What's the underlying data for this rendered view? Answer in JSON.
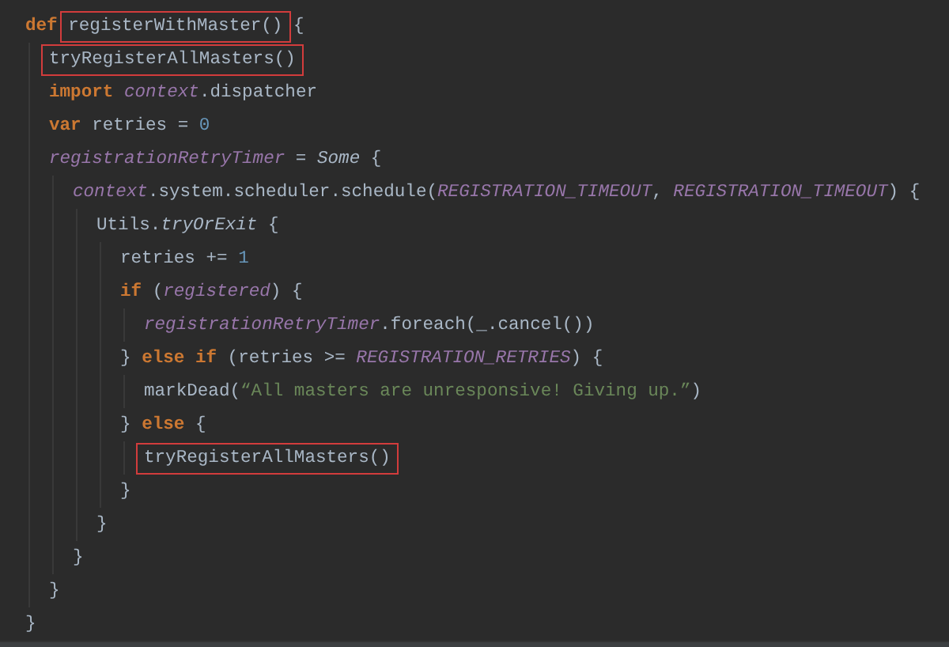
{
  "editor": {
    "lines": [
      {
        "tokens": [
          {
            "kind": "keyword",
            "text": "def "
          },
          {
            "kind": "plain",
            "text": "registerWithMaster()",
            "boxed": true
          },
          {
            "kind": "plain",
            "text": " {"
          }
        ],
        "children": [
          {
            "tokens": [
              {
                "kind": "plain",
                "text": "tryRegisterAllMasters()",
                "boxed": true
              }
            ]
          },
          {
            "tokens": [
              {
                "kind": "keyword",
                "text": "import "
              },
              {
                "kind": "member",
                "text": "context"
              },
              {
                "kind": "plain",
                "text": ".dispatcher"
              }
            ]
          },
          {
            "tokens": [
              {
                "kind": "keyword",
                "text": "var"
              },
              {
                "kind": "plain",
                "text": " retries = "
              },
              {
                "kind": "number",
                "text": "0"
              }
            ]
          },
          {
            "tokens": [
              {
                "kind": "member",
                "text": "registrationRetryTimer"
              },
              {
                "kind": "plain",
                "text": " = "
              },
              {
                "kind": "call",
                "text": "Some"
              },
              {
                "kind": "plain",
                "text": " {"
              }
            ],
            "children": [
              {
                "tokens": [
                  {
                    "kind": "member",
                    "text": "context"
                  },
                  {
                    "kind": "plain",
                    "text": ".system.scheduler.schedule("
                  },
                  {
                    "kind": "member",
                    "text": "REGISTRATION_TIMEOUT"
                  },
                  {
                    "kind": "plain",
                    "text": ", "
                  },
                  {
                    "kind": "member",
                    "text": "REGISTRATION_TIMEOUT"
                  },
                  {
                    "kind": "plain",
                    "text": ") {"
                  }
                ],
                "children": [
                  {
                    "tokens": [
                      {
                        "kind": "plain",
                        "text": "Utils."
                      },
                      {
                        "kind": "call",
                        "text": "tryOrExit"
                      },
                      {
                        "kind": "plain",
                        "text": " {"
                      }
                    ],
                    "children": [
                      {
                        "tokens": [
                          {
                            "kind": "plain",
                            "text": "retries += "
                          },
                          {
                            "kind": "number",
                            "text": "1"
                          }
                        ]
                      },
                      {
                        "tokens": [
                          {
                            "kind": "keyword",
                            "text": "if"
                          },
                          {
                            "kind": "plain",
                            "text": " ("
                          },
                          {
                            "kind": "member",
                            "text": "registered"
                          },
                          {
                            "kind": "plain",
                            "text": ") {"
                          }
                        ],
                        "children": [
                          {
                            "tokens": [
                              {
                                "kind": "member",
                                "text": "registrationRetryTimer"
                              },
                              {
                                "kind": "plain",
                                "text": ".foreach(_.cancel())"
                              }
                            ]
                          }
                        ]
                      },
                      {
                        "tokens": [
                          {
                            "kind": "plain",
                            "text": "} "
                          },
                          {
                            "kind": "keyword",
                            "text": "else if"
                          },
                          {
                            "kind": "plain",
                            "text": " (retries >= "
                          },
                          {
                            "kind": "member",
                            "text": "REGISTRATION_RETRIES"
                          },
                          {
                            "kind": "plain",
                            "text": ") {"
                          }
                        ],
                        "children": [
                          {
                            "tokens": [
                              {
                                "kind": "plain",
                                "text": "markDead("
                              },
                              {
                                "kind": "string",
                                "text": "“All masters are unresponsive! Giving up.”"
                              },
                              {
                                "kind": "plain",
                                "text": ")"
                              }
                            ]
                          }
                        ]
                      },
                      {
                        "tokens": [
                          {
                            "kind": "plain",
                            "text": "} "
                          },
                          {
                            "kind": "keyword",
                            "text": "else"
                          },
                          {
                            "kind": "plain",
                            "text": " {"
                          }
                        ],
                        "children": [
                          {
                            "tokens": [
                              {
                                "kind": "plain",
                                "text": "tryRegisterAllMasters()",
                                "boxed": true
                              }
                            ]
                          }
                        ]
                      },
                      {
                        "tokens": [
                          {
                            "kind": "plain",
                            "text": "}"
                          }
                        ]
                      }
                    ]
                  },
                  {
                    "tokens": [
                      {
                        "kind": "plain",
                        "text": "}"
                      }
                    ]
                  }
                ]
              },
              {
                "tokens": [
                  {
                    "kind": "plain",
                    "text": "}"
                  }
                ]
              }
            ]
          },
          {
            "tokens": [
              {
                "kind": "plain",
                "text": "}"
              }
            ]
          }
        ]
      },
      {
        "tokens": [
          {
            "kind": "plain",
            "text": "}"
          }
        ]
      }
    ]
  }
}
